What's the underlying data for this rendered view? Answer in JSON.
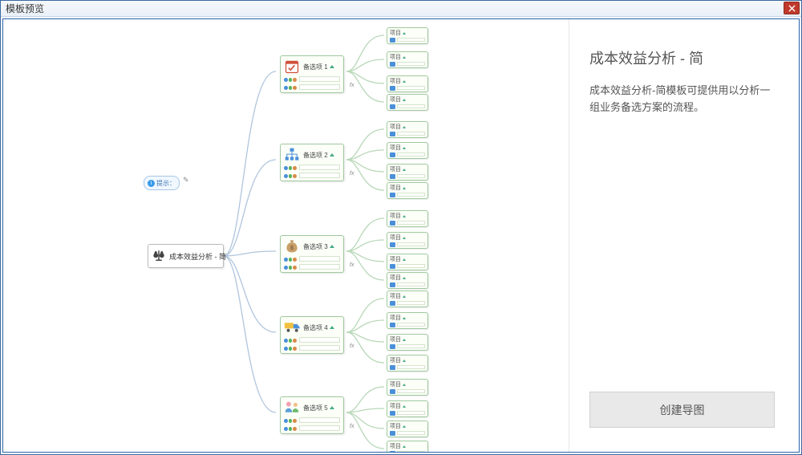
{
  "window": {
    "title": "模板预览"
  },
  "hint": {
    "label": "提示："
  },
  "root": {
    "label": "成本效益分析 - 简"
  },
  "options": [
    {
      "label": "备选项 1",
      "icon": "calendar"
    },
    {
      "label": "备选项 2",
      "icon": "hierarchy"
    },
    {
      "label": "备选项 3",
      "icon": "moneybag"
    },
    {
      "label": "备选项 4",
      "icon": "truck"
    },
    {
      "label": "备选项 5",
      "icon": "people"
    }
  ],
  "item": {
    "label": "项目"
  },
  "fx": "fx",
  "side": {
    "title": "成本效益分析 - 简",
    "description": "成本效益分析-简模板可提供用以分析一组业务备选方案的流程。",
    "button": "创建导图"
  }
}
